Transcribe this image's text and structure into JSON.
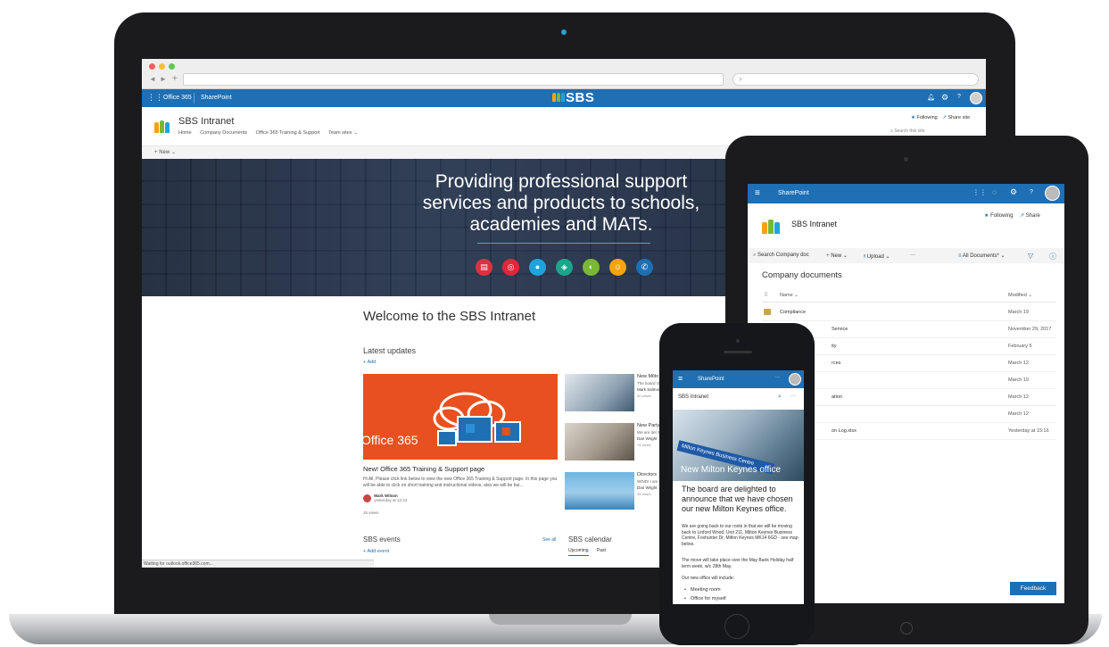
{
  "laptop": {
    "browser": {
      "back": "◄",
      "fwd": "►",
      "new_tab": "+",
      "search_glyph": "⌕"
    },
    "suite_bar": {
      "app1": "Office 365",
      "app2": "SharePoint",
      "brand": "SBS"
    },
    "site": {
      "title": "SBS Intranet",
      "nav": [
        "Home",
        "Company Documents",
        "Office 365 Training & Support",
        "Team sites"
      ],
      "following": "Following",
      "share": "Share site",
      "search_placeholder": "Search this site",
      "new_label": "New"
    },
    "hero": {
      "line1": "Providing professional support",
      "line2": "services and products to schools,",
      "line3": "academies and MATs.",
      "icon_colors": [
        "#d9333f",
        "#e3263a",
        "#1ea4dd",
        "#19a68b",
        "#7ab833",
        "#f5a40c",
        "#1e6fb4"
      ]
    },
    "welcome": "Welcome to the SBS Intranet",
    "latest": {
      "heading": "Latest updates",
      "add": "Add"
    },
    "main_news": {
      "image_text": "Office 365",
      "title": "New! Office 365 Training & Support page",
      "body": "Hi All, Please click link below to view the new Office 365 Training & Support page. In this page you will be able to click on short training and instructional videos, also we will be bui...",
      "author": "Mark Wilson",
      "when": "yesterday at 12:23",
      "views": "26 views"
    },
    "side_news": [
      {
        "title": "New Milto",
        "snippet": "The board chosen our",
        "author": "Mark Salmon",
        "views": "40 views"
      },
      {
        "title": "New Party",
        "snippet": "We are del SBS. Primar",
        "author": "Dan Wright",
        "views": "74 views"
      },
      {
        "title": "Directors",
        "snippet": "WIND! I am news from",
        "author": "Dan Wright",
        "views": "34 views"
      }
    ],
    "events": {
      "heading": "SBS events",
      "add": "Add event",
      "see_all": "See all"
    },
    "calendar": {
      "heading": "SBS calendar",
      "tab1": "Upcoming",
      "tab2": "Past"
    },
    "status": "Waiting for outlook.office365.com..."
  },
  "tablet": {
    "app": "SharePoint",
    "site_title": "SBS Intranet",
    "following": "Following",
    "share": "Share",
    "cmd": {
      "search": "Search Company doc",
      "new": "New",
      "upload": "Upload",
      "more": "···",
      "view": "All Documents*"
    },
    "heading": "Company documents",
    "col_name": "Name",
    "col_modified": "Modified",
    "rows": [
      {
        "name": "Compliance",
        "modified": "March 19"
      },
      {
        "name": "Service",
        "modified": "November 29, 2017"
      },
      {
        "name": "ity",
        "modified": "February 5"
      },
      {
        "name": "rces",
        "modified": "March 12"
      },
      {
        "name": "",
        "modified": "March 19"
      },
      {
        "name": "ation",
        "modified": "March 12"
      },
      {
        "name": "",
        "modified": "March 12"
      },
      {
        "name": "on Log.xlsx",
        "modified": "Yesterday at 15:16"
      }
    ],
    "feedback": "Feedback"
  },
  "phone": {
    "app": "SharePoint",
    "more": "···",
    "site_title": "SBS Intranet",
    "sign": "Milton Keynes Business Centre",
    "headline": "New Milton Keynes office",
    "lede": "The board are delighted to announce that we have chosen our new Milton Keynes office.",
    "p1": "We are going back to our roots in that we will be moving back to Linford Wood. Unit 211, Milton Keynes Business Centre, Foxhunter Dr, Milton Keynes MK14 6GD - see map below.",
    "p2": "The move will take place over the May Bank Holiday half term week, w/c 28th May.",
    "p3": "Our new office will include:",
    "bullets": [
      "Meeting room",
      "Office for myself"
    ]
  }
}
